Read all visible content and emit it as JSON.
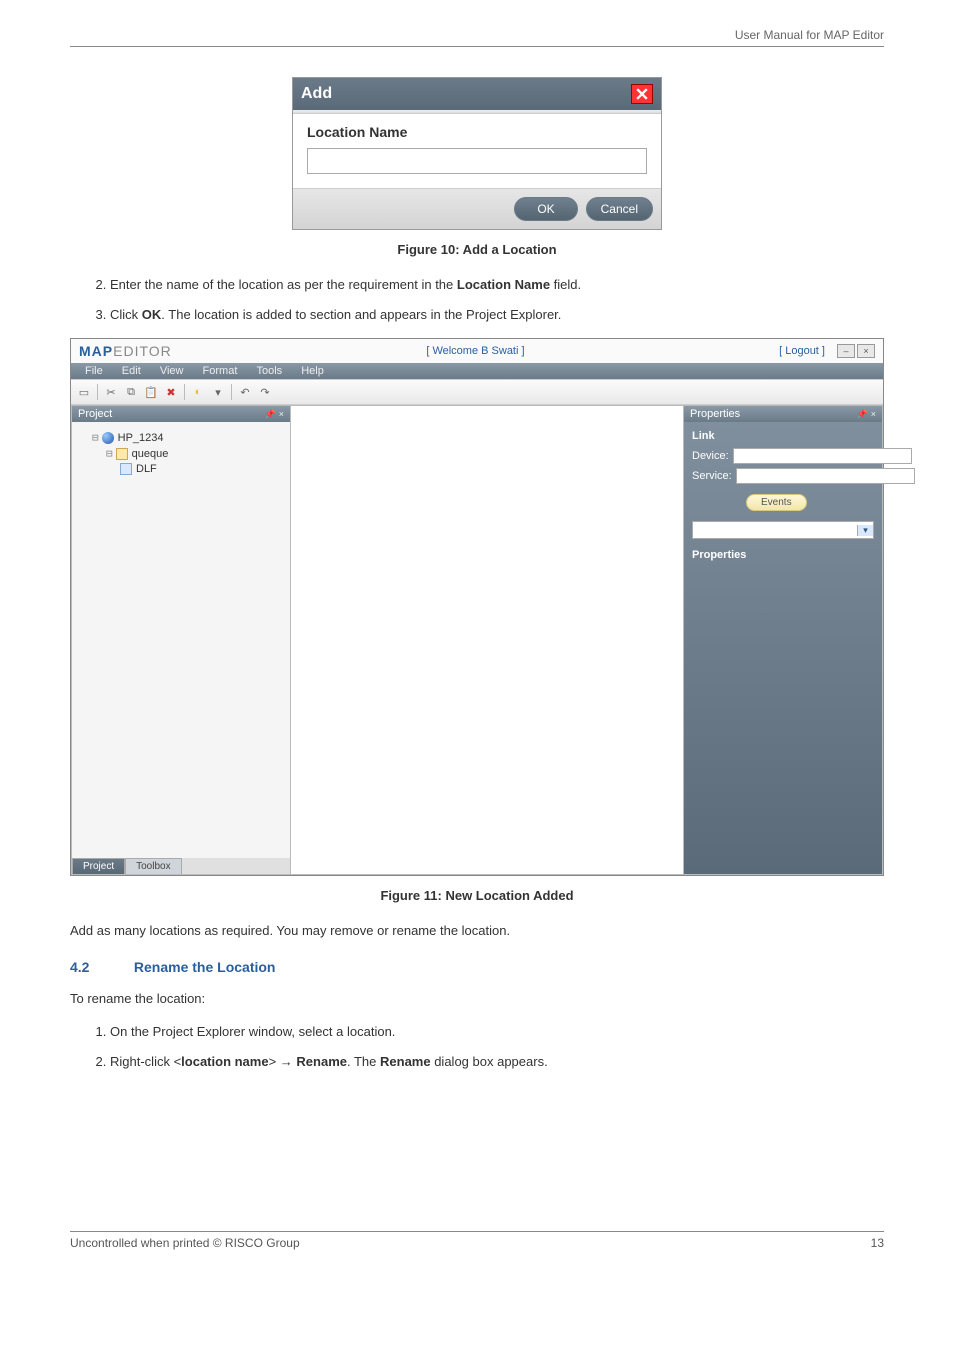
{
  "header": {
    "doc_title": "User Manual for MAP Editor"
  },
  "dialog": {
    "title": "Add",
    "label": "Location Name",
    "value": "",
    "ok": "OK",
    "cancel": "Cancel"
  },
  "fig10": "Figure 10: Add a Location",
  "step2": "Enter the name of the location as per the requirement in the ",
  "step2b": "Location Name",
  "step2c": " field.",
  "step3a": "Click ",
  "step3b": "OK",
  "step3c": ". The location is added to section and appears in the Project Explorer.",
  "app": {
    "logo_map": "MAP",
    "logo_editor": "EDITOR",
    "welcome": "[ Welcome  B Swati  ]",
    "logout": "[ Logout ]",
    "menus": [
      "File",
      "Edit",
      "View",
      "Format",
      "Tools",
      "Help"
    ],
    "left_panel_title": "Project",
    "tree": {
      "root": "HP_1234",
      "child1": "queque",
      "child2": "DLF"
    },
    "right_panel_title": "Properties",
    "link_hdr": "Link",
    "device_lbl": "Device:",
    "service_lbl": "Service:",
    "events_btn": "Events",
    "props_sub": "Properties",
    "tab_project": "Project",
    "tab_toolbox": "Toolbox"
  },
  "fig11": "Figure 11: New Location Added",
  "afterfig": "Add as many locations as required. You may remove or rename the location.",
  "section": {
    "num": "4.2",
    "title": "Rename the Location"
  },
  "rename_intro": "To rename the location:",
  "rstep1": "On the Project Explorer window, select a location.",
  "rstep2a": "Right-click <",
  "rstep2b": "location name",
  "rstep2c": "> → ",
  "rstep2d": "Rename",
  "rstep2e": ". The ",
  "rstep2f": "Rename",
  "rstep2g": " dialog box appears.",
  "footer": {
    "left": "Uncontrolled when printed © RISCO Group",
    "right": "13"
  }
}
